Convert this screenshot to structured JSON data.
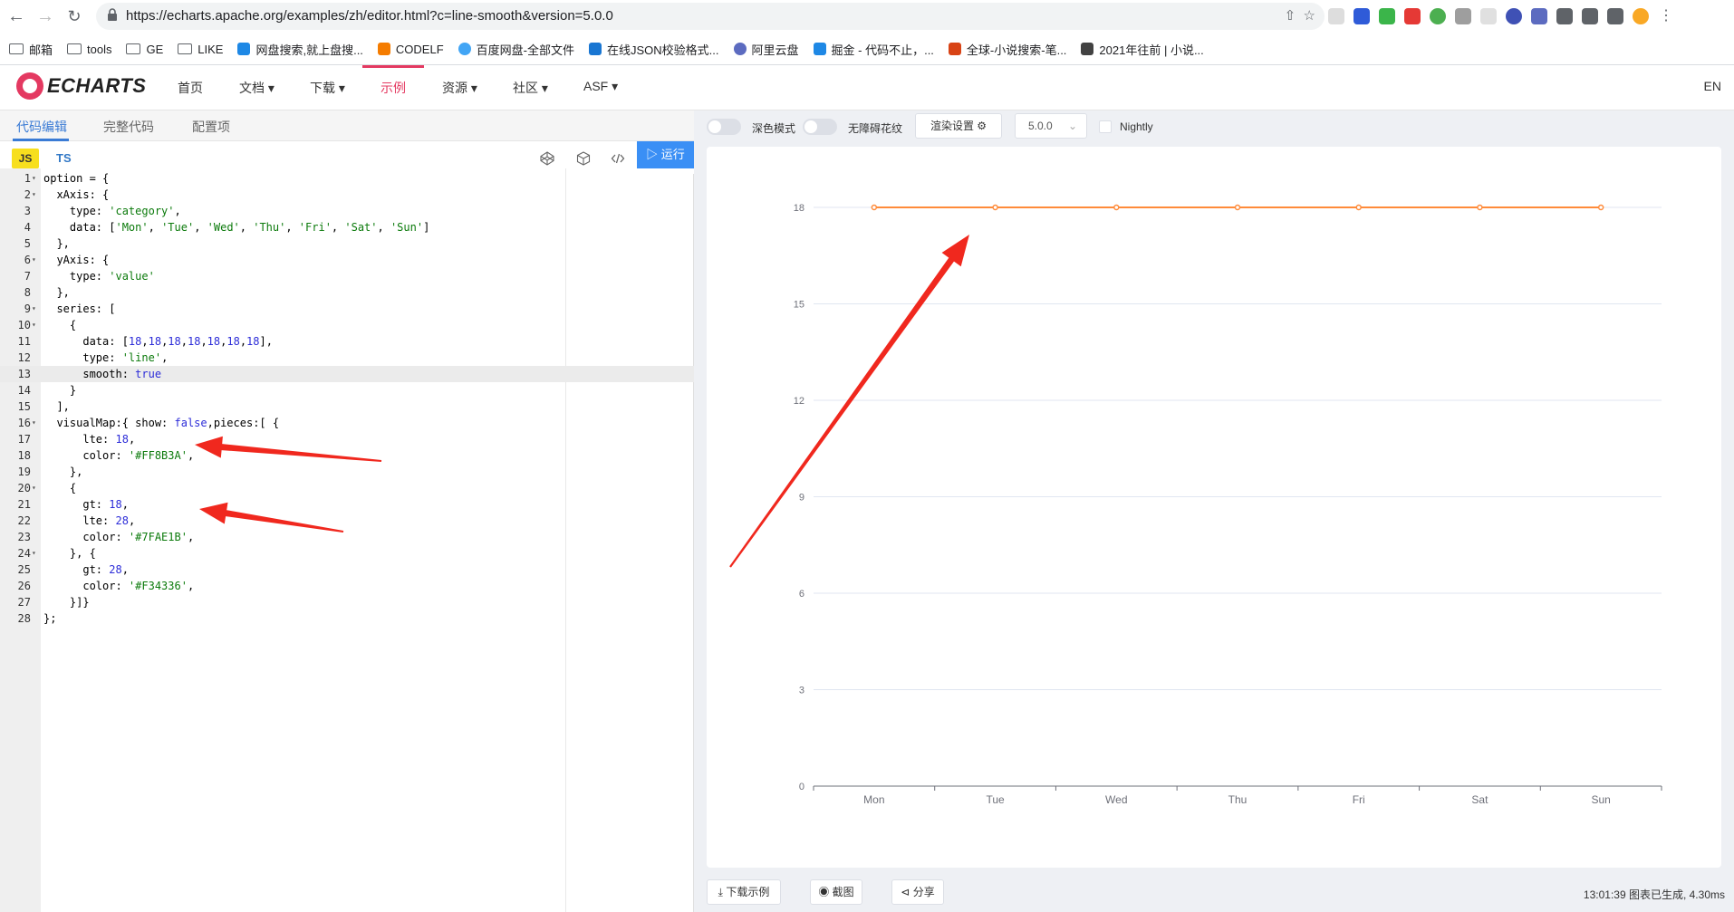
{
  "browser": {
    "url": "https://echarts.apache.org/examples/zh/editor.html?c=line-smooth&version=5.0.0",
    "bookmarks": [
      "邮箱",
      "tools",
      "GE",
      "LIKE",
      "网盘搜索,就上盘搜...",
      "CODELF",
      "百度网盘-全部文件",
      "在线JSON校验格式...",
      "阿里云盘",
      "掘金 - 代码不止，...",
      "全球-小说搜索-笔...",
      "2021年往前 | 小说..."
    ]
  },
  "site": {
    "logo_text": "ECHARTS",
    "nav": [
      "首页",
      "文档",
      "下载",
      "示例",
      "资源",
      "社区",
      "ASF"
    ],
    "lang": "EN"
  },
  "editor": {
    "tabs": [
      "代码编辑",
      "完整代码",
      "配置项"
    ],
    "lang_js": "JS",
    "lang_ts": "TS",
    "run_label": "运行",
    "code_lines": [
      "option = {",
      "  xAxis: {",
      "    type: 'category',",
      "    data: ['Mon', 'Tue', 'Wed', 'Thu', 'Fri', 'Sat', 'Sun']",
      "  },",
      "  yAxis: {",
      "    type: 'value'",
      "  },",
      "  series: [",
      "    {",
      "      data: [18,18,18,18,18,18,18],",
      "      type: 'line',",
      "      smooth: true",
      "    }",
      "  ],",
      "  visualMap:{ show: false,pieces:[ {",
      "      lte: 18,",
      "      color: '#FF8B3A',",
      "    },",
      "    {",
      "      gt: 18,",
      "      lte: 28,",
      "      color: '#7FAE1B',",
      "    }, {",
      "      gt: 28,",
      "      color: '#F34336',",
      "    }]}",
      "};"
    ],
    "fold_lines": [
      1,
      2,
      6,
      9,
      10,
      16,
      20,
      24
    ],
    "highlight_line": 13
  },
  "preview": {
    "dark_mode_label": "深色模式",
    "decal_label": "无障碍花纹",
    "render_settings_label": "渲染设置",
    "version": "5.0.0",
    "nightly_label": "Nightly",
    "download_label": "下载示例",
    "screenshot_label": "截图",
    "share_label": "分享",
    "status_text": "13:01:39  图表已生成, 4.30ms"
  },
  "chart_data": {
    "type": "line",
    "categories": [
      "Mon",
      "Tue",
      "Wed",
      "Thu",
      "Fri",
      "Sat",
      "Sun"
    ],
    "values": [
      18,
      18,
      18,
      18,
      18,
      18,
      18
    ],
    "ylim": [
      0,
      18
    ],
    "yticks": [
      0,
      3,
      6,
      9,
      12,
      15,
      18
    ],
    "line_color": "#FF8B3A",
    "grid": true
  },
  "annotations": {
    "arrow_color": "#F0281E"
  }
}
